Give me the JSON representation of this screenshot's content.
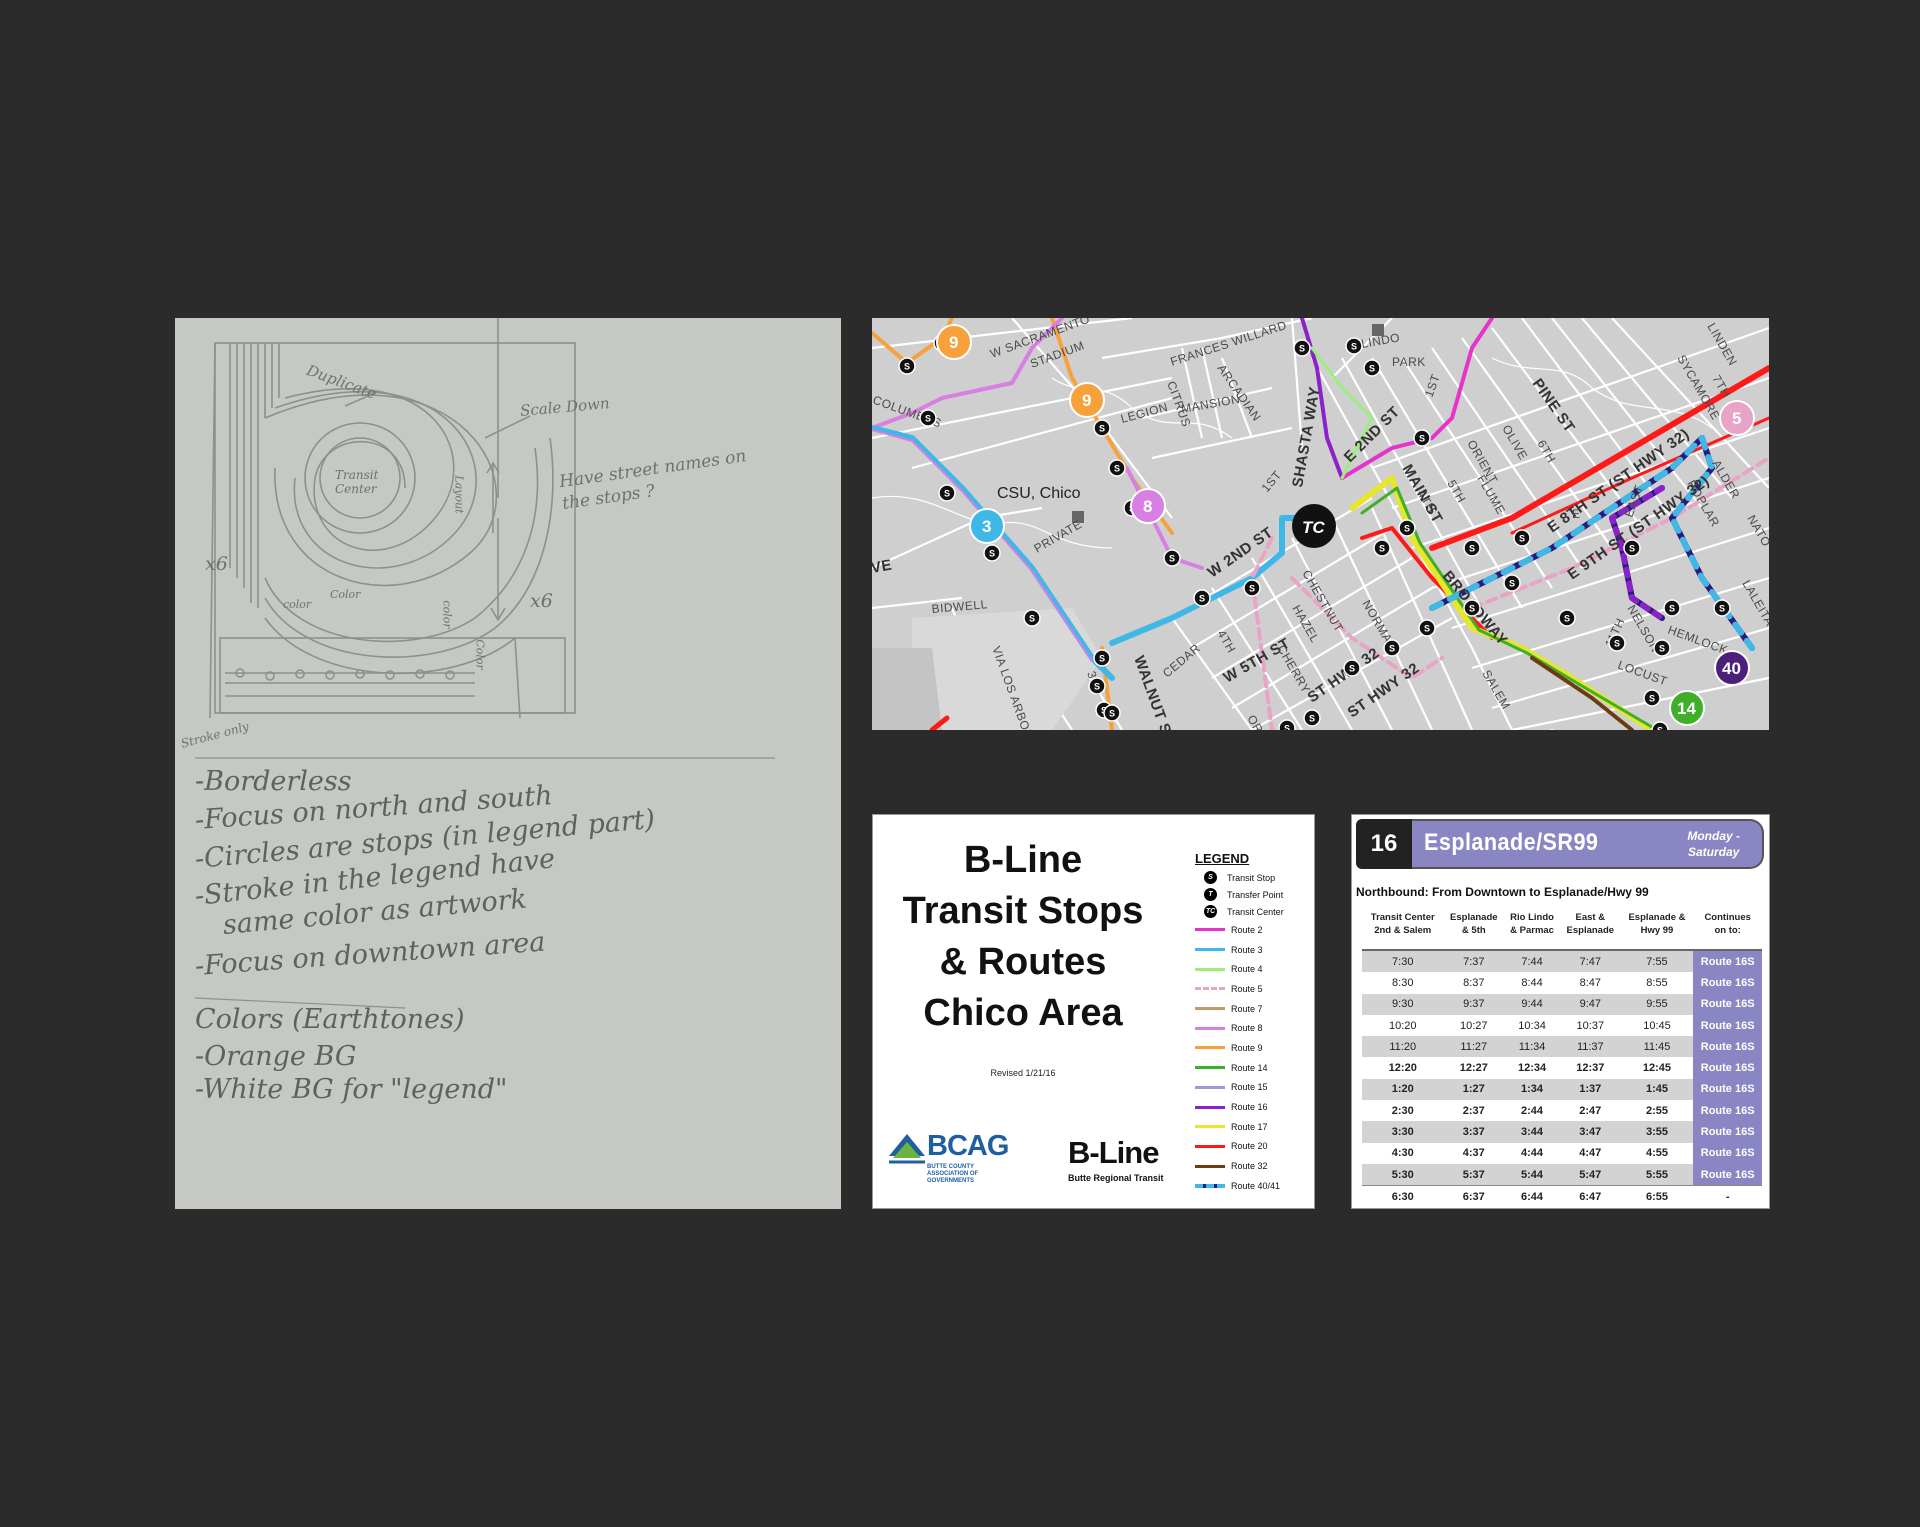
{
  "sketch": {
    "annotations": [
      "Duplicate",
      "Scale Down",
      "Have street names on the stops ?",
      "Transit Center",
      "x6",
      "x6",
      "Stroke only",
      "Color",
      "color",
      "color",
      "Color",
      "Layout"
    ],
    "notes": [
      "-Borderless",
      "-Focus on north and south",
      "-Circles are stops (in legend part)",
      "-Stroke in the legend have",
      "same color as artwork",
      "-Focus on downtown area",
      "Colors (Earthtones)",
      "-Orange BG",
      "-White BG for \"legend\""
    ]
  },
  "map": {
    "streets": [
      "W SACRAMENTO",
      "FRANCES WILLARD",
      "LEGION",
      "CITRUS",
      "ARCADIAN",
      "MANSION",
      "SHASTA WAY",
      "LINDO",
      "PARK",
      "1ST",
      "E 2ND ST",
      "PINE ST",
      "OLIVE",
      "6TH",
      "ORIENT",
      "FLUME",
      "5TH",
      "4TH",
      "SYCAMORE",
      "LINDEN",
      "7TH",
      "ALDER",
      "POPLAR",
      "E 8TH ST (ST HWY 32)",
      "E 9TH ST (ST HWY 32)",
      "MAIN ST",
      "BROADWAY",
      "W 2ND ST",
      "1ST",
      "CHESTNUT",
      "NORMAL",
      "HAZEL",
      "W 5TH ST",
      "4TH",
      "CHERRY",
      "ST HWY 32",
      "ST HWY 32",
      "SALEM",
      "11TH",
      "NELSON",
      "LOCUST",
      "HEMLOCK",
      "EAST",
      "LALEITA",
      "NATO",
      "BIDWELL",
      "VIA LOS ARBOLES",
      "WALNUT ST",
      "CEDAR",
      "ORANGE",
      "PRIVATE",
      "COLUMBUS",
      "STADIUM",
      "3RD",
      "E",
      "VE"
    ],
    "place_label": "CSU, Chico",
    "transit_center_label": "TC",
    "route_badges": [
      {
        "num": "9",
        "color": "#f7a13c"
      },
      {
        "num": "9",
        "color": "#f7a13c"
      },
      {
        "num": "8",
        "color": "#d77fe2"
      },
      {
        "num": "3",
        "color": "#3fb8e8"
      },
      {
        "num": "5",
        "color": "#e8a3c6"
      },
      {
        "num": "40",
        "color": "#4b1f7a"
      },
      {
        "num": "14",
        "color": "#3fae2a"
      }
    ],
    "stop_symbol": "S"
  },
  "legend_card": {
    "title_lines": [
      "B-Line",
      "Transit Stops",
      "& Routes",
      "Chico Area"
    ],
    "revised": "Revised 1/21/16",
    "bcag_name": "BCAG",
    "bcag_sub": "BUTTE COUNTY ASSOCIATION OF GOVERNMENTS",
    "bline_name": "B-Line",
    "bline_sub": "Butte Regional Transit",
    "legend_title": "LEGEND",
    "symbols": [
      {
        "glyph": "S",
        "label": "Transit Stop"
      },
      {
        "glyph": "T",
        "label": "Transfer Point"
      },
      {
        "glyph": "TC",
        "label": "Transit Center"
      }
    ],
    "routes": [
      {
        "label": "Route 2",
        "color": "#e633c9",
        "style": "solid"
      },
      {
        "label": "Route 3",
        "color": "#3fb8e8",
        "style": "solid"
      },
      {
        "label": "Route 4",
        "color": "#9cf07a",
        "style": "solid"
      },
      {
        "label": "Route 5",
        "color": "#e8a3c6",
        "style": "dashed"
      },
      {
        "label": "Route 7",
        "color": "#c29a68",
        "style": "solid"
      },
      {
        "label": "Route 8",
        "color": "#d77fe2",
        "style": "solid"
      },
      {
        "label": "Route 9",
        "color": "#f7a13c",
        "style": "solid"
      },
      {
        "label": "Route 14",
        "color": "#3fae2a",
        "style": "solid"
      },
      {
        "label": "Route 15",
        "color": "#9a9ad8",
        "style": "solid"
      },
      {
        "label": "Route 16",
        "color": "#8b22c9",
        "style": "solid"
      },
      {
        "label": "Route 17",
        "color": "#e6e62a",
        "style": "solid"
      },
      {
        "label": "Route 20",
        "color": "#ff1a1a",
        "style": "solid"
      },
      {
        "label": "Route 32",
        "color": "#6b3b12",
        "style": "solid"
      },
      {
        "label": "Route 40/41",
        "color": "#2a1a7a",
        "style": "dashed-blue"
      }
    ]
  },
  "timetable": {
    "route_number": "16",
    "route_name": "Esplanade/SR99",
    "days_line1": "Monday -",
    "days_line2": "Saturday",
    "direction": "Northbound: From Downtown to Esplanade/Hwy 99",
    "columns": [
      [
        "Transit Center",
        "2nd & Salem"
      ],
      [
        "Esplanade",
        "& 5th"
      ],
      [
        "Rio Lindo",
        "& Parmac"
      ],
      [
        "East &",
        "Esplanade"
      ],
      [
        "Esplanade &",
        "Hwy 99"
      ],
      [
        "Continues",
        "on to:"
      ]
    ],
    "rows": [
      {
        "times": [
          "7:30",
          "7:37",
          "7:44",
          "7:47",
          "7:55"
        ],
        "cont": "Route 16S",
        "bold": false
      },
      {
        "times": [
          "8:30",
          "8:37",
          "8:44",
          "8:47",
          "8:55"
        ],
        "cont": "Route 16S",
        "bold": false
      },
      {
        "times": [
          "9:30",
          "9:37",
          "9:44",
          "9:47",
          "9:55"
        ],
        "cont": "Route 16S",
        "bold": false
      },
      {
        "times": [
          "10:20",
          "10:27",
          "10:34",
          "10:37",
          "10:45"
        ],
        "cont": "Route 16S",
        "bold": false
      },
      {
        "times": [
          "11:20",
          "11:27",
          "11:34",
          "11:37",
          "11:45"
        ],
        "cont": "Route 16S",
        "bold": false
      },
      {
        "times": [
          "12:20",
          "12:27",
          "12:34",
          "12:37",
          "12:45"
        ],
        "cont": "Route 16S",
        "bold": true
      },
      {
        "times": [
          "1:20",
          "1:27",
          "1:34",
          "1:37",
          "1:45"
        ],
        "cont": "Route 16S",
        "bold": true
      },
      {
        "times": [
          "2:30",
          "2:37",
          "2:44",
          "2:47",
          "2:55"
        ],
        "cont": "Route 16S",
        "bold": true
      },
      {
        "times": [
          "3:30",
          "3:37",
          "3:44",
          "3:47",
          "3:55"
        ],
        "cont": "Route 16S",
        "bold": true
      },
      {
        "times": [
          "4:30",
          "4:37",
          "4:44",
          "4:47",
          "4:55"
        ],
        "cont": "Route 16S",
        "bold": true
      },
      {
        "times": [
          "5:30",
          "5:37",
          "5:44",
          "5:47",
          "5:55"
        ],
        "cont": "Route 16S",
        "bold": true
      },
      {
        "times": [
          "6:30",
          "6:37",
          "6:44",
          "6:47",
          "6:55"
        ],
        "cont": "-",
        "bold": true
      }
    ]
  }
}
